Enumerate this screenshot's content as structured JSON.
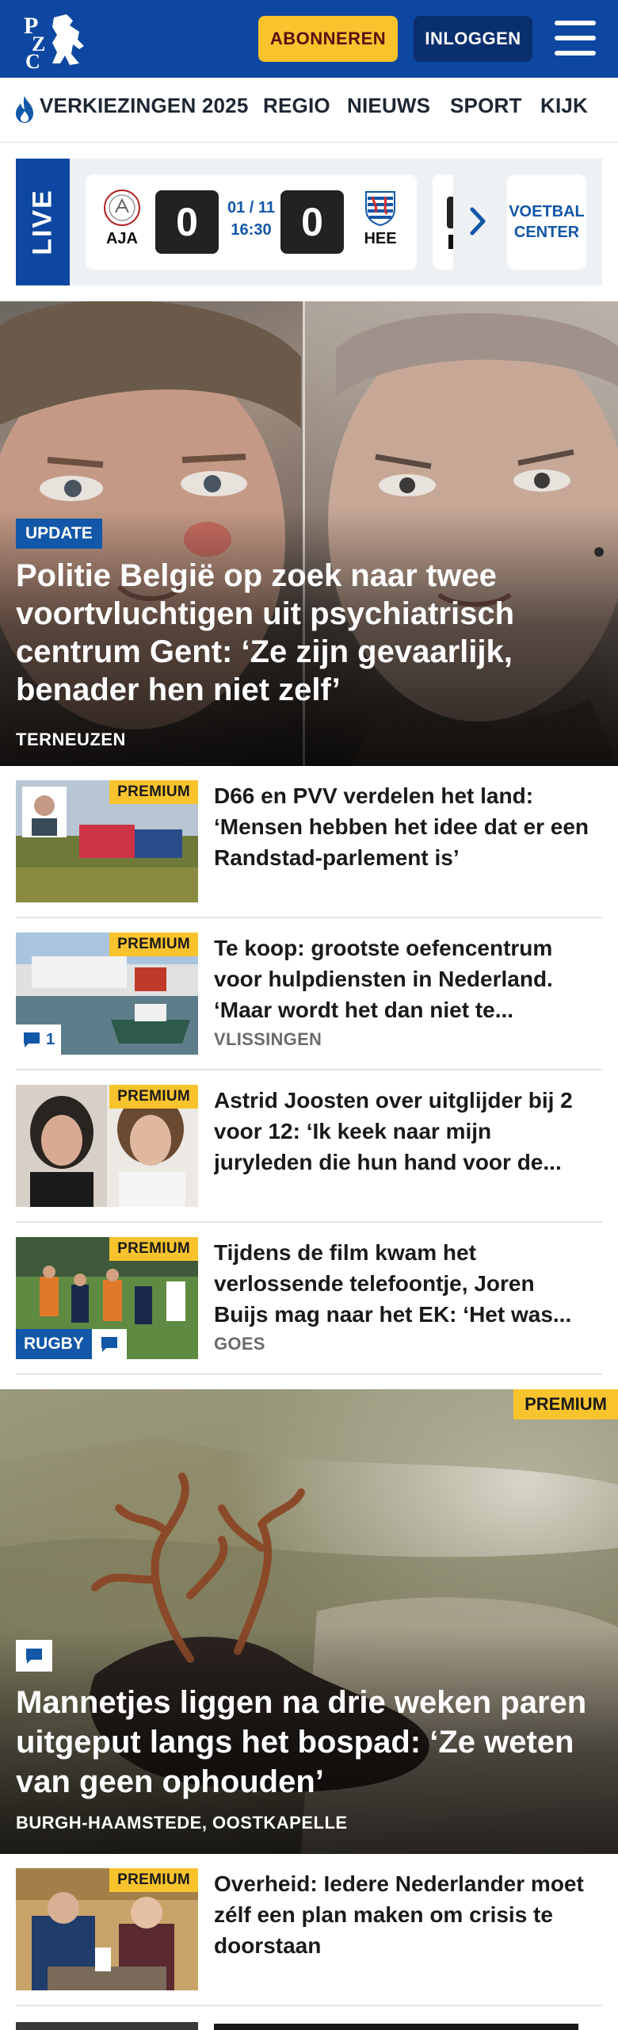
{
  "header": {
    "logo_text": "PZC",
    "subscribe_label": "ABONNEREN",
    "login_label": "INLOGGEN",
    "colors": {
      "brand_blue": "#0d47a1",
      "subscribe_yellow": "#f9c32e"
    }
  },
  "nav": {
    "items": [
      {
        "label": "VERKIEZINGEN 2025",
        "icon": "flame-icon"
      },
      {
        "label": "REGIO"
      },
      {
        "label": "NIEUWS"
      },
      {
        "label": "SPORT"
      },
      {
        "label": "KIJK"
      }
    ]
  },
  "live": {
    "label": "LIVE",
    "match": {
      "home_code": "AJA",
      "home_score": "0",
      "date": "01 / 11",
      "time": "16:30",
      "away_score": "0",
      "away_code": "HEE"
    },
    "center_label_1": "VOETBAL",
    "center_label_2": "CENTER"
  },
  "hero": {
    "badge": "UPDATE",
    "title": "Politie België op zoek naar twee voortvluchtigen uit psychiatrisch centrum Gent: ‘Ze zijn gevaarlijk, benader hen niet zelf’",
    "location": "TERNEUZEN"
  },
  "articles": [
    {
      "premium": "PREMIUM",
      "title": "D66 en PVV verdelen het land: ‘Mensen hebben het idee dat er een Randstad-parlement is’",
      "location": ""
    },
    {
      "premium": "PREMIUM",
      "title": "Te koop: grootste oefencentrum voor hulpdiensten in Nederland. ‘Maar wordt het dan niet te...",
      "location": "VLISSINGEN",
      "comments": "1"
    },
    {
      "premium": "PREMIUM",
      "title": "Astrid Joosten over uitglijder bij 2 voor 12: ‘Ik keek naar mijn juryleden die hun hand voor de...",
      "location": ""
    },
    {
      "premium": "PREMIUM",
      "title": "Tijdens de film kwam het verlossende telefoontje, Joren Buijs mag naar het EK: ‘Het was...",
      "location": "GOES",
      "tag": "RUGBY"
    }
  ],
  "feature": {
    "premium": "PREMIUM",
    "title": "Mannetjes liggen na drie weken paren uitgeput langs het bospad: ‘Ze weten van geen ophouden’",
    "location": "BURGH-HAAMSTEDE, OOSTKAPELLE"
  },
  "article_after": {
    "premium": "PREMIUM",
    "title": "Overheid: Iedere Nederlander moet zélf een plan maken om crisis te doorstaan"
  }
}
